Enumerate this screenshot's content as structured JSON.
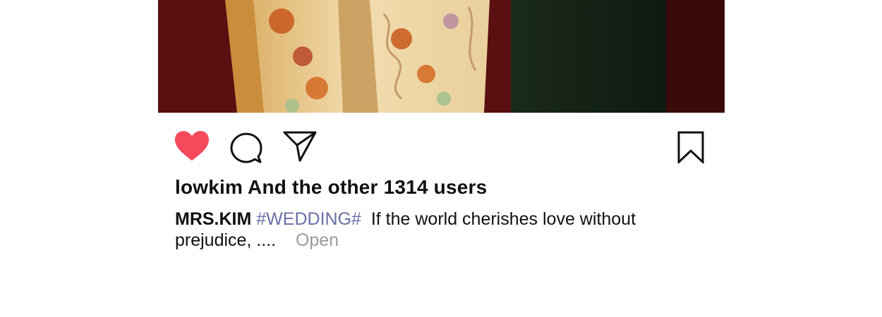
{
  "post": {
    "photo_alt": "wedding photo",
    "actions": {
      "like_icon": "heart-filled-icon",
      "comment_icon": "comment-bubble-icon",
      "share_icon": "paper-plane-icon",
      "save_icon": "bookmark-icon",
      "like_color": "#f44a5c",
      "liked": true
    },
    "likes_text": "lowkim And the other 1314 users",
    "caption": {
      "author": "MRS.KIM",
      "hashtag": "#WEDDING#",
      "text_line1": "If the world cherishes love without",
      "text_line2": "prejudice, ....",
      "open_label": "Open"
    }
  }
}
